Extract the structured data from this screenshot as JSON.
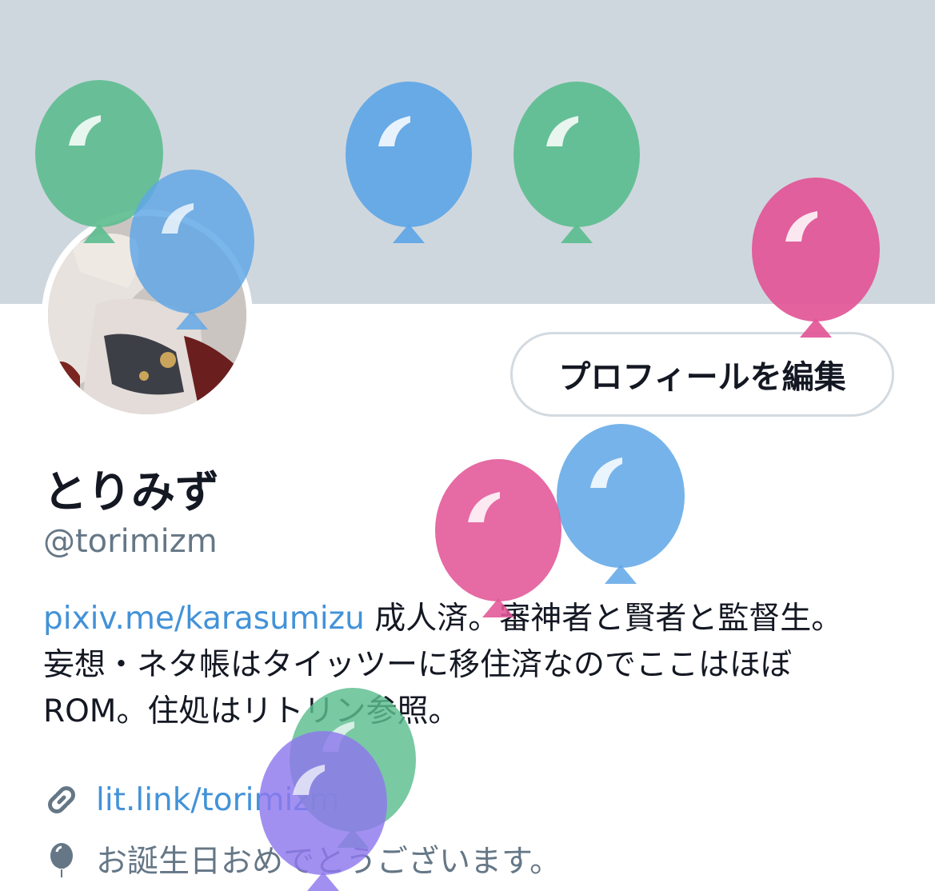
{
  "profile": {
    "display_name": "とりみず",
    "handle": "@torimizm",
    "edit_button_label": "プロフィールを編集",
    "bio": {
      "link": "pixiv.me/karasumizu",
      "line1_rest": " 成人済。審神者と賢者と監督生。",
      "line2": "妄想・ネタ帳はタイッツーに移住済なのでここはほぼ",
      "line3": "ROM。住処はリトリン参照。"
    },
    "website": "lit.link/torimizm",
    "birthday_text": "お誕生日おめでとうございます。"
  },
  "colors": {
    "banner": "#cfd7de",
    "link": "#4392d8",
    "text": "#141823",
    "secondary_text": "#657786",
    "balloon_green": "#5cbd8f",
    "balloon_blue": "#5ea6e6",
    "balloon_pink": "#e25596",
    "balloon_purple": "#8e78ee"
  },
  "icons": {
    "link": "link-icon",
    "birthday": "balloon-icon"
  }
}
